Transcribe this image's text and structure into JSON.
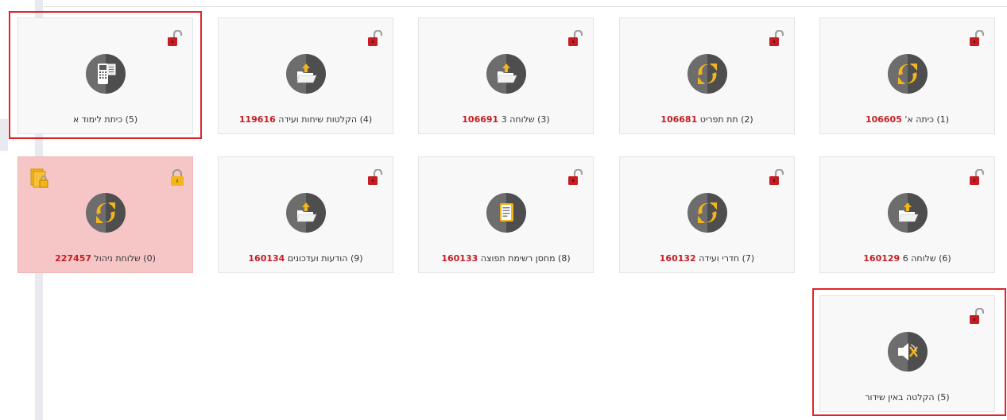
{
  "tiles": [
    {
      "index": "(5)",
      "name": "כיתת לימוד א",
      "code": "",
      "icon": "keypad-device-icon",
      "lock": "red-unlocked",
      "alert": false,
      "highlighted": true
    },
    {
      "index": "(4)",
      "name": "הקלטות שיחות ועידה",
      "code": "119616",
      "icon": "folder-upload-icon",
      "lock": "red-unlocked",
      "alert": false,
      "highlighted": false
    },
    {
      "index": "(3)",
      "name": "שלוחה 3",
      "code": "106691",
      "icon": "folder-upload-icon",
      "lock": "red-unlocked",
      "alert": false,
      "highlighted": false
    },
    {
      "index": "(2)",
      "name": "תת תפריט",
      "code": "106681",
      "icon": "refresh-arrows-icon",
      "lock": "red-unlocked",
      "alert": false,
      "highlighted": false
    },
    {
      "index": "(1)",
      "name": "כיתה א'",
      "code": "106605",
      "icon": "refresh-arrows-icon",
      "lock": "red-unlocked",
      "alert": false,
      "highlighted": false
    },
    {
      "index": "(0)",
      "name": "שלוחת ניהול",
      "code": "227457",
      "icon": "refresh-arrows-icon",
      "lock": "yellow-locked",
      "alert": true,
      "highlighted": false
    },
    {
      "index": "(9)",
      "name": "הודעות ועדכונים",
      "code": "160134",
      "icon": "folder-upload-icon",
      "lock": "red-unlocked",
      "alert": false,
      "highlighted": false
    },
    {
      "index": "(8)",
      "name": "מחסן רשימת תפוצה",
      "code": "160133",
      "icon": "document-list-icon",
      "lock": "red-unlocked",
      "alert": false,
      "highlighted": false
    },
    {
      "index": "(7)",
      "name": "חדרי ועידה",
      "code": "160132",
      "icon": "refresh-arrows-icon",
      "lock": "red-unlocked",
      "alert": false,
      "highlighted": false
    },
    {
      "index": "(6)",
      "name": "שלוחה 6",
      "code": "160129",
      "icon": "folder-upload-icon",
      "lock": "red-unlocked",
      "alert": false,
      "highlighted": false
    },
    {
      "index": "(5)",
      "name": "הקלטה באין שידור",
      "code": "",
      "icon": "speaker-mute-icon",
      "lock": "red-unlocked",
      "alert": false,
      "highlighted": true
    }
  ],
  "colors": {
    "code": "#c41e24",
    "alert_bg": "#f6c6c6",
    "highlight": "#e0242b",
    "icon_accent": "#f3b51b"
  }
}
